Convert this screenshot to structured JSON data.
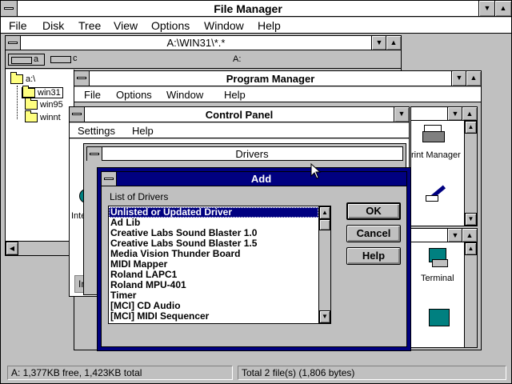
{
  "file_manager": {
    "title": "File Manager",
    "menu": [
      "File",
      "Disk",
      "Tree",
      "View",
      "Options",
      "Window",
      "Help"
    ],
    "child_title": "A:\\WIN31\\*.*",
    "drive_a": "a",
    "drive_c": "c",
    "volume_label": "A:",
    "tree": [
      "a:\\",
      "win31",
      "win95",
      "winnt"
    ],
    "status_left": "A: 1,377KB free, 1,423KB total",
    "status_right": "Total 2 file(s) (1,806 bytes)"
  },
  "program_manager": {
    "title": "Program Manager",
    "menu": [
      "File",
      "Options",
      "Window",
      "Help"
    ],
    "icons": [
      "rint Manager",
      "Terminal"
    ]
  },
  "control_panel": {
    "title": "Control Panel",
    "menu": [
      "Settings",
      "Help"
    ],
    "partial_labels": [
      "Inte",
      "In"
    ]
  },
  "drivers_dialog": {
    "title": "Drivers"
  },
  "add_dialog": {
    "title": "Add",
    "list_label": "List of Drivers",
    "drivers": [
      "Unlisted or Updated Driver",
      "Ad Lib",
      "Creative Labs Sound Blaster 1.0",
      "Creative Labs Sound Blaster 1.5",
      "Media Vision Thunder Board",
      "MIDI Mapper",
      "Roland LAPC1",
      "Roland MPU-401",
      "Timer",
      "[MCI] CD Audio",
      "[MCI] MIDI Sequencer"
    ],
    "selected_index": 0,
    "ok": "OK",
    "cancel": "Cancel",
    "help": "Help"
  },
  "colors": {
    "active_title": "#000080",
    "desktop": "#c0c0c0",
    "folder": "#ffff80"
  }
}
